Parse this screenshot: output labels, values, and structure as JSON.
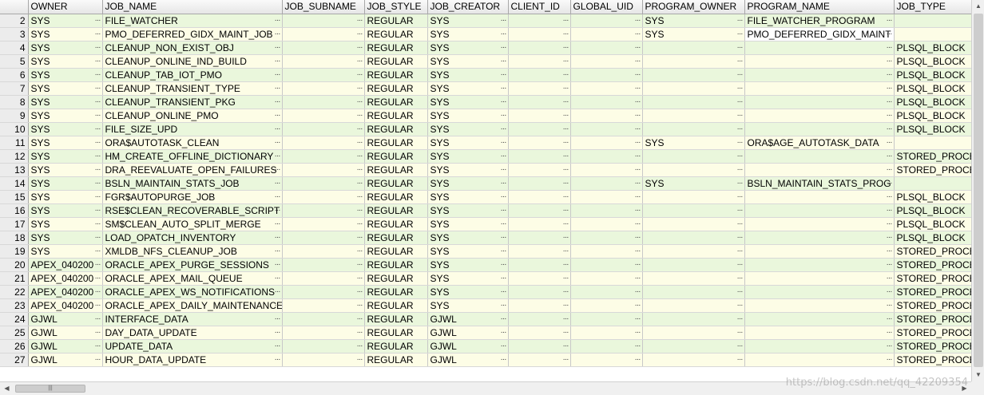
{
  "columns": [
    "",
    "OWNER",
    "JOB_NAME",
    "JOB_SUBNAME",
    "JOB_STYLE",
    "JOB_CREATOR",
    "CLIENT_ID",
    "GLOBAL_UID",
    "PROGRAM_OWNER",
    "PROGRAM_NAME",
    "JOB_TYPE"
  ],
  "rows": [
    {
      "n": "2",
      "owner": "SYS",
      "job_name": "FILE_WATCHER",
      "job_subname": "",
      "job_style": "REGULAR",
      "job_creator": "SYS",
      "client_id": "",
      "global_uid": "",
      "program_owner": "SYS",
      "program_name": "FILE_WATCHER_PROGRAM",
      "job_type": ""
    },
    {
      "n": "3",
      "owner": "SYS",
      "job_name": "PMO_DEFERRED_GIDX_MAINT_JOB",
      "job_subname": "",
      "job_style": "REGULAR",
      "job_creator": "SYS",
      "client_id": "",
      "global_uid": "",
      "program_owner": "SYS",
      "program_name": "PMO_DEFERRED_GIDX_MAINT",
      "job_type": ""
    },
    {
      "n": "4",
      "owner": "SYS",
      "job_name": "CLEANUP_NON_EXIST_OBJ",
      "job_subname": "",
      "job_style": "REGULAR",
      "job_creator": "SYS",
      "client_id": "",
      "global_uid": "",
      "program_owner": "",
      "program_name": "",
      "job_type": "PLSQL_BLOCK"
    },
    {
      "n": "5",
      "owner": "SYS",
      "job_name": "CLEANUP_ONLINE_IND_BUILD",
      "job_subname": "",
      "job_style": "REGULAR",
      "job_creator": "SYS",
      "client_id": "",
      "global_uid": "",
      "program_owner": "",
      "program_name": "",
      "job_type": "PLSQL_BLOCK"
    },
    {
      "n": "6",
      "owner": "SYS",
      "job_name": "CLEANUP_TAB_IOT_PMO",
      "job_subname": "",
      "job_style": "REGULAR",
      "job_creator": "SYS",
      "client_id": "",
      "global_uid": "",
      "program_owner": "",
      "program_name": "",
      "job_type": "PLSQL_BLOCK"
    },
    {
      "n": "7",
      "owner": "SYS",
      "job_name": "CLEANUP_TRANSIENT_TYPE",
      "job_subname": "",
      "job_style": "REGULAR",
      "job_creator": "SYS",
      "client_id": "",
      "global_uid": "",
      "program_owner": "",
      "program_name": "",
      "job_type": "PLSQL_BLOCK"
    },
    {
      "n": "8",
      "owner": "SYS",
      "job_name": "CLEANUP_TRANSIENT_PKG",
      "job_subname": "",
      "job_style": "REGULAR",
      "job_creator": "SYS",
      "client_id": "",
      "global_uid": "",
      "program_owner": "",
      "program_name": "",
      "job_type": "PLSQL_BLOCK"
    },
    {
      "n": "9",
      "owner": "SYS",
      "job_name": "CLEANUP_ONLINE_PMO",
      "job_subname": "",
      "job_style": "REGULAR",
      "job_creator": "SYS",
      "client_id": "",
      "global_uid": "",
      "program_owner": "",
      "program_name": "",
      "job_type": "PLSQL_BLOCK"
    },
    {
      "n": "10",
      "owner": "SYS",
      "job_name": "FILE_SIZE_UPD",
      "job_subname": "",
      "job_style": "REGULAR",
      "job_creator": "SYS",
      "client_id": "",
      "global_uid": "",
      "program_owner": "",
      "program_name": "",
      "job_type": "PLSQL_BLOCK"
    },
    {
      "n": "11",
      "owner": "SYS",
      "job_name": "ORA$AUTOTASK_CLEAN",
      "job_subname": "",
      "job_style": "REGULAR",
      "job_creator": "SYS",
      "client_id": "",
      "global_uid": "",
      "program_owner": "SYS",
      "program_name": "ORA$AGE_AUTOTASK_DATA",
      "job_type": ""
    },
    {
      "n": "12",
      "owner": "SYS",
      "job_name": "HM_CREATE_OFFLINE_DICTIONARY",
      "job_subname": "",
      "job_style": "REGULAR",
      "job_creator": "SYS",
      "client_id": "",
      "global_uid": "",
      "program_owner": "",
      "program_name": "",
      "job_type": "STORED_PROCED"
    },
    {
      "n": "13",
      "owner": "SYS",
      "job_name": "DRA_REEVALUATE_OPEN_FAILURES",
      "job_subname": "",
      "job_style": "REGULAR",
      "job_creator": "SYS",
      "client_id": "",
      "global_uid": "",
      "program_owner": "",
      "program_name": "",
      "job_type": "STORED_PROCED"
    },
    {
      "n": "14",
      "owner": "SYS",
      "job_name": "BSLN_MAINTAIN_STATS_JOB",
      "job_subname": "",
      "job_style": "REGULAR",
      "job_creator": "SYS",
      "client_id": "",
      "global_uid": "",
      "program_owner": "SYS",
      "program_name": "BSLN_MAINTAIN_STATS_PROG",
      "job_type": ""
    },
    {
      "n": "15",
      "owner": "SYS",
      "job_name": "FGR$AUTOPURGE_JOB",
      "job_subname": "",
      "job_style": "REGULAR",
      "job_creator": "SYS",
      "client_id": "",
      "global_uid": "",
      "program_owner": "",
      "program_name": "",
      "job_type": "PLSQL_BLOCK"
    },
    {
      "n": "16",
      "owner": "SYS",
      "job_name": "RSE$CLEAN_RECOVERABLE_SCRIPT",
      "job_subname": "",
      "job_style": "REGULAR",
      "job_creator": "SYS",
      "client_id": "",
      "global_uid": "",
      "program_owner": "",
      "program_name": "",
      "job_type": "PLSQL_BLOCK"
    },
    {
      "n": "17",
      "owner": "SYS",
      "job_name": "SM$CLEAN_AUTO_SPLIT_MERGE",
      "job_subname": "",
      "job_style": "REGULAR",
      "job_creator": "SYS",
      "client_id": "",
      "global_uid": "",
      "program_owner": "",
      "program_name": "",
      "job_type": "PLSQL_BLOCK"
    },
    {
      "n": "18",
      "owner": "SYS",
      "job_name": "LOAD_OPATCH_INVENTORY",
      "job_subname": "",
      "job_style": "REGULAR",
      "job_creator": "SYS",
      "client_id": "",
      "global_uid": "",
      "program_owner": "",
      "program_name": "",
      "job_type": "PLSQL_BLOCK"
    },
    {
      "n": "19",
      "owner": "SYS",
      "job_name": "XMLDB_NFS_CLEANUP_JOB",
      "job_subname": "",
      "job_style": "REGULAR",
      "job_creator": "SYS",
      "client_id": "",
      "global_uid": "",
      "program_owner": "",
      "program_name": "",
      "job_type": "STORED_PROCED"
    },
    {
      "n": "20",
      "owner": "APEX_040200",
      "job_name": "ORACLE_APEX_PURGE_SESSIONS",
      "job_subname": "",
      "job_style": "REGULAR",
      "job_creator": "SYS",
      "client_id": "",
      "global_uid": "",
      "program_owner": "",
      "program_name": "",
      "job_type": "STORED_PROCED"
    },
    {
      "n": "21",
      "owner": "APEX_040200",
      "job_name": "ORACLE_APEX_MAIL_QUEUE",
      "job_subname": "",
      "job_style": "REGULAR",
      "job_creator": "SYS",
      "client_id": "",
      "global_uid": "",
      "program_owner": "",
      "program_name": "",
      "job_type": "STORED_PROCED"
    },
    {
      "n": "22",
      "owner": "APEX_040200",
      "job_name": "ORACLE_APEX_WS_NOTIFICATIONS",
      "job_subname": "",
      "job_style": "REGULAR",
      "job_creator": "SYS",
      "client_id": "",
      "global_uid": "",
      "program_owner": "",
      "program_name": "",
      "job_type": "STORED_PROCED"
    },
    {
      "n": "23",
      "owner": "APEX_040200",
      "job_name": "ORACLE_APEX_DAILY_MAINTENANCE",
      "job_subname": "",
      "job_style": "REGULAR",
      "job_creator": "SYS",
      "client_id": "",
      "global_uid": "",
      "program_owner": "",
      "program_name": "",
      "job_type": "STORED_PROCED"
    },
    {
      "n": "24",
      "owner": "GJWL",
      "job_name": "INTERFACE_DATA",
      "job_subname": "",
      "job_style": "REGULAR",
      "job_creator": "GJWL",
      "client_id": "",
      "global_uid": "",
      "program_owner": "",
      "program_name": "",
      "job_type": "STORED_PROCED"
    },
    {
      "n": "25",
      "owner": "GJWL",
      "job_name": "DAY_DATA_UPDATE",
      "job_subname": "",
      "job_style": "REGULAR",
      "job_creator": "GJWL",
      "client_id": "",
      "global_uid": "",
      "program_owner": "",
      "program_name": "",
      "job_type": "STORED_PROCED"
    },
    {
      "n": "26",
      "owner": "GJWL",
      "job_name": "UPDATE_DATA",
      "job_subname": "",
      "job_style": "REGULAR",
      "job_creator": "GJWL",
      "client_id": "",
      "global_uid": "",
      "program_owner": "",
      "program_name": "",
      "job_type": "STORED_PROCED"
    },
    {
      "n": "27",
      "owner": "GJWL",
      "job_name": "HOUR_DATA_UPDATE",
      "job_subname": "",
      "job_style": "REGULAR",
      "job_creator": "GJWL",
      "client_id": "",
      "global_uid": "",
      "program_owner": "",
      "program_name": "",
      "job_type": "STORED_PROCED"
    }
  ],
  "ellipsis": "···",
  "scrollbar": {
    "up": "▲",
    "down": "▼",
    "left": "◀",
    "right": "▶",
    "grip": "|||"
  },
  "watermark": "https://blog.csdn.net/qq_42209354",
  "colors": {
    "row_green": "#eaf7dc",
    "row_yellow": "#fdfde6",
    "header": "#e6e6e6"
  }
}
